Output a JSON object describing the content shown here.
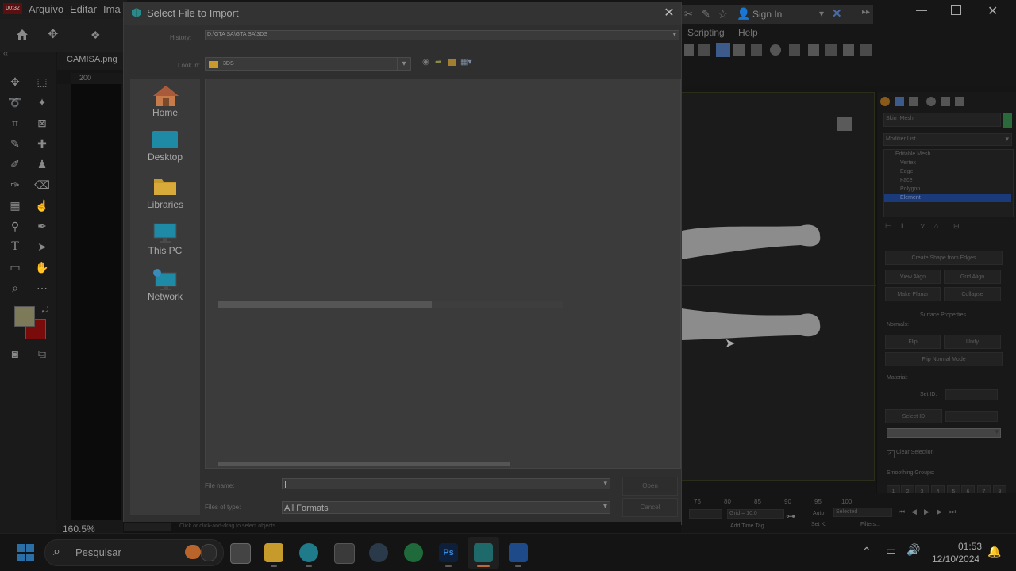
{
  "photoshop": {
    "clock_badge": "00:32",
    "menu": [
      "Arquivo",
      "Editar",
      "Ima"
    ],
    "doc_tab": "CAMISA.png",
    "ruler_tick": "200",
    "zoom": "160.5%"
  },
  "max": {
    "menu": [
      "Scripting",
      "Help"
    ],
    "sign_in": "Sign In",
    "object_name": "Skin_Mesh",
    "modifier_list": "Modifier List",
    "modifier_stack": [
      "Editable Mesh",
      "Vertex",
      "Edge",
      "Face",
      "Polygon",
      "Element"
    ],
    "selected_stack_item": "Element",
    "buttons": {
      "create_shape": "Create Shape from Edges",
      "view_align": "View Align",
      "grid_align": "Grid Align",
      "make_planar": "Make Planar",
      "collapse": "Collapse",
      "flip": "Flip",
      "unify": "Unify",
      "flip_normal_mode": "Flip Normal Mode"
    },
    "rollouts": {
      "surface_properties": "Surface Properties",
      "normals": "Normals:",
      "material": "Material:",
      "set_id": "Set ID:",
      "select_id": "Select ID",
      "clear_selection": "Clear Selection",
      "smoothing_groups": "Smoothing Groups:"
    },
    "smoothing_numbers": [
      "1",
      "2",
      "3",
      "4",
      "5",
      "6",
      "7",
      "8"
    ],
    "timeline_ticks": [
      "75",
      "80",
      "85",
      "90",
      "95",
      "100"
    ],
    "grid": "Grid = 10,0",
    "auto": "Auto",
    "set_k": "Set K.",
    "selected": "Selected",
    "filters": "Filters...",
    "add_time_tag": "Add Time Tag",
    "status_prompt": "Click or click-and-drag to select objects"
  },
  "dialog": {
    "title": "Select File to Import",
    "history_label": "History:",
    "history_value": "D:\\GTA SA\\GTA SA\\3DS",
    "lookin_label": "Look in:",
    "lookin_value": "3DS",
    "places": [
      {
        "label": "Home",
        "icon": "home-icon"
      },
      {
        "label": "Desktop",
        "icon": "desktop-icon"
      },
      {
        "label": "Libraries",
        "icon": "libraries-icon"
      },
      {
        "label": "This PC",
        "icon": "this-pc-icon"
      },
      {
        "label": "Network",
        "icon": "network-icon"
      }
    ],
    "filename_label": "File name:",
    "filename_value": "",
    "filetype_label": "Files of type:",
    "filetype_value": "All Formats",
    "open_label": "Open",
    "cancel_label": "Cancel"
  },
  "taskbar": {
    "search_placeholder": "Pesquisar",
    "time": "01:53",
    "date": "12/10/2024"
  },
  "colors": {
    "ps_foreground": "#7d7a5a",
    "ps_background": "#7a0b0b",
    "max_selection": "#1b3a7a",
    "folder": "#c79a2c",
    "monitor": "#1f8aa6"
  }
}
